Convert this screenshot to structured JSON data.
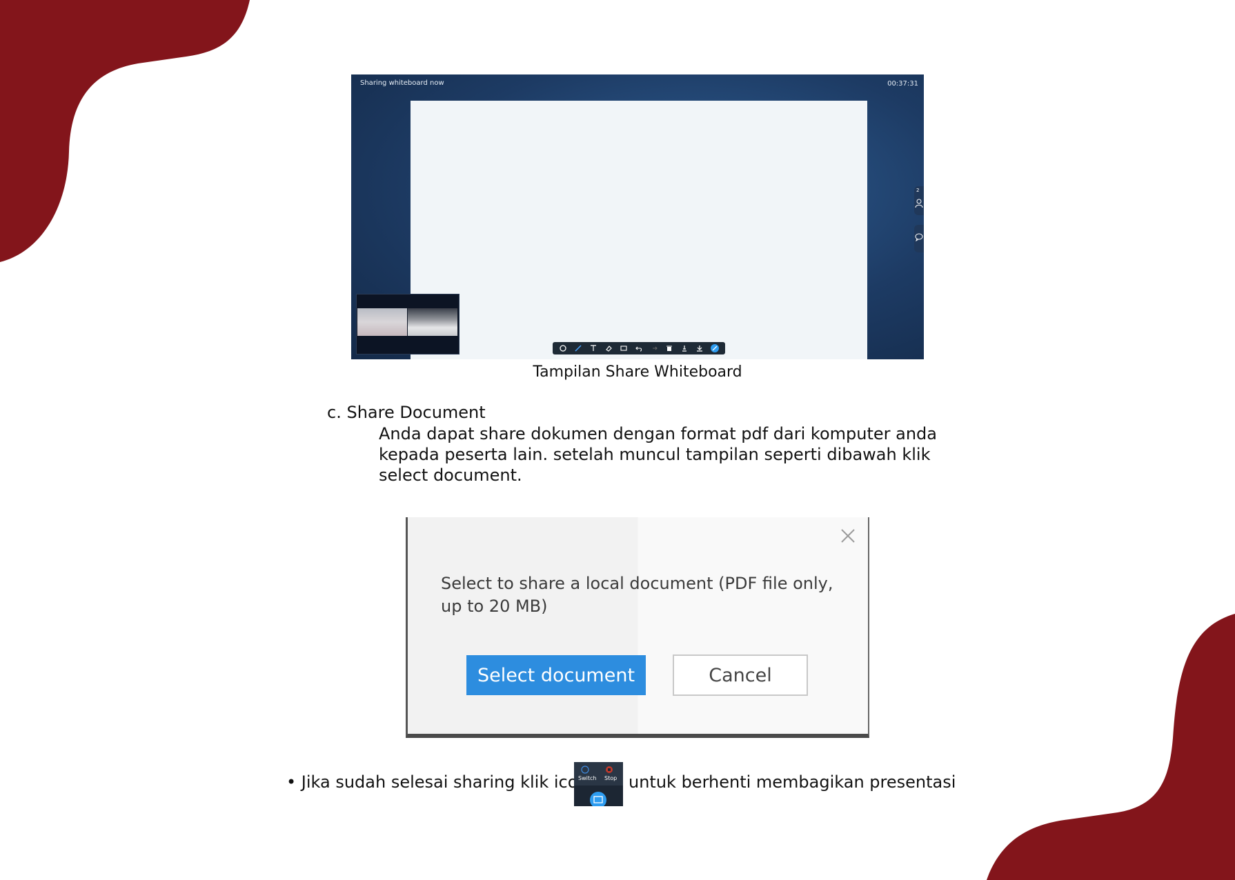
{
  "whiteboard_screenshot": {
    "status_text": "Sharing whiteboard now",
    "timer": "00:37:31",
    "participant_count": "2",
    "caption": "Tampilan Share Whiteboard"
  },
  "section": {
    "heading": "c. Share Document",
    "paragraph": "Anda dapat share dokumen dengan format pdf dari komputer anda kepada peserta lain. setelah muncul tampilan seperti dibawah klik select document."
  },
  "dialog": {
    "message": "Select to share a local document (PDF file only, up to 20 MB)",
    "select_label": "Select document",
    "cancel_label": "Cancel"
  },
  "footer_note": {
    "before_icon": "• Jika sudah selesai sharing klik icon",
    "after_icon": "untuk berhenti membagikan presentasi",
    "icon_labels": {
      "switch": "Switch",
      "stop": "Stop"
    }
  },
  "colors": {
    "brand_maroon": "#83151b",
    "select_blue": "#2d8ddf"
  }
}
